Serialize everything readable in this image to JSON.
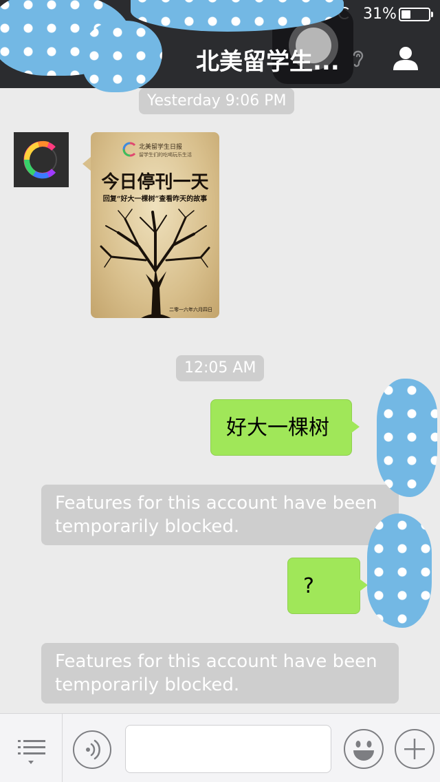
{
  "status_bar": {
    "battery_text": "31%",
    "battery_level": 0.31
  },
  "header": {
    "title": "北美留学生...",
    "icons": [
      "ear-icon",
      "user-icon"
    ]
  },
  "messages": {
    "timestamp_1": "Yesterday 9:06 PM",
    "poster": {
      "logo_text": "北美留学生日报",
      "small_text": "留学生们的吃喝玩乐生活",
      "headline": "今日停刊一天",
      "subtitle": "回复“好大一棵树”查看昨天的故事",
      "date": "二零一六年六月四日"
    },
    "timestamp_2": "12:05 AM",
    "sent_1": "好大一棵树",
    "notice_1": "Features for this account have been temporarily blocked.",
    "sent_2": "?",
    "notice_2": "Features for this account have been temporarily blocked."
  },
  "input_bar": {
    "icons": [
      "menu-icon",
      "voice-icon",
      "emoji-icon",
      "plus-icon"
    ],
    "input_value": ""
  },
  "colors": {
    "header_bg": "#2b2c2f",
    "chat_bg": "#ebebeb",
    "sent_bubble": "#a0e759",
    "notice_bg": "#cecece",
    "redaction_blue": "#73b8e4"
  }
}
